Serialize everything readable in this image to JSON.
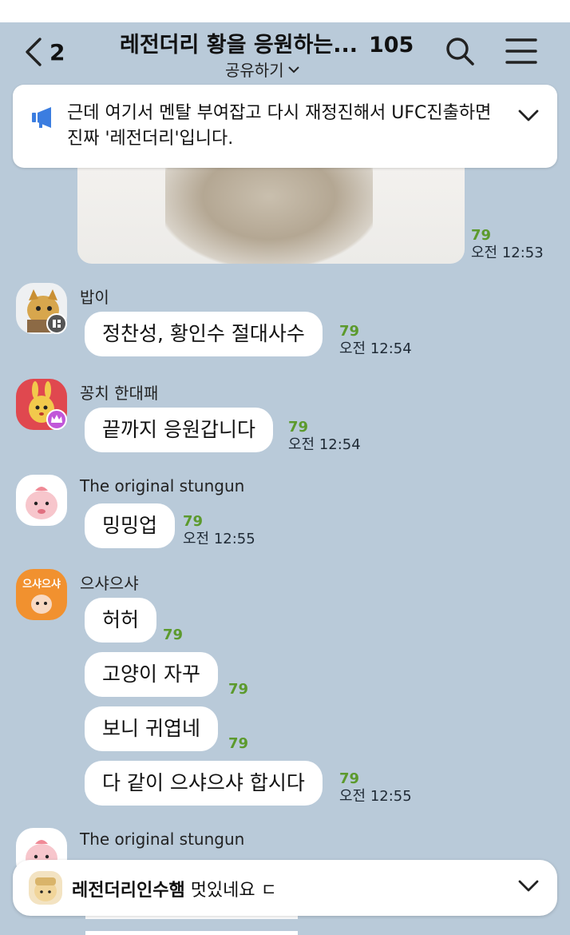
{
  "header": {
    "back_count": "2",
    "title": "레전더리 황을 응원하는...",
    "member_count": "105",
    "share_label": "공유하기"
  },
  "notice": {
    "text": "근데 여기서 멘탈 부여잡고 다시 재정진해서 UFC진출하면 진짜 '레전더리'입니다."
  },
  "image_message": {
    "read_count": "79",
    "time": "오전 12:53"
  },
  "messages": [
    {
      "sender": "밥이",
      "text": "정찬성, 황인수 절대사수",
      "read_count": "79",
      "time": "오전 12:54"
    },
    {
      "sender": "꽁치 한대패",
      "text": "끝까지 응원갑니다",
      "read_count": "79",
      "time": "오전 12:54"
    },
    {
      "sender": "The original stungun",
      "text": "밍밍업",
      "read_count": "79",
      "time": "오전 12:55"
    },
    {
      "sender": "으샤으샤",
      "avatar_label": "으샤으샤",
      "lines": [
        {
          "text": "허허",
          "read_count": "79"
        },
        {
          "text": "고양이 자꾸",
          "read_count": "79"
        },
        {
          "text": "보니 귀엽네",
          "read_count": "79"
        },
        {
          "text": "다 같이 으샤으샤 합시다",
          "read_count": "79",
          "time": "오전 12:55"
        }
      ]
    },
    {
      "sender": "The original stungun"
    }
  ],
  "bottom_bar": {
    "sender": "레전더리인수햄",
    "text": "멋있네요 ㄷ"
  },
  "colors": {
    "background": "#b9cad9",
    "read_count": "#5c9a2d",
    "bubble": "#ffffff"
  }
}
